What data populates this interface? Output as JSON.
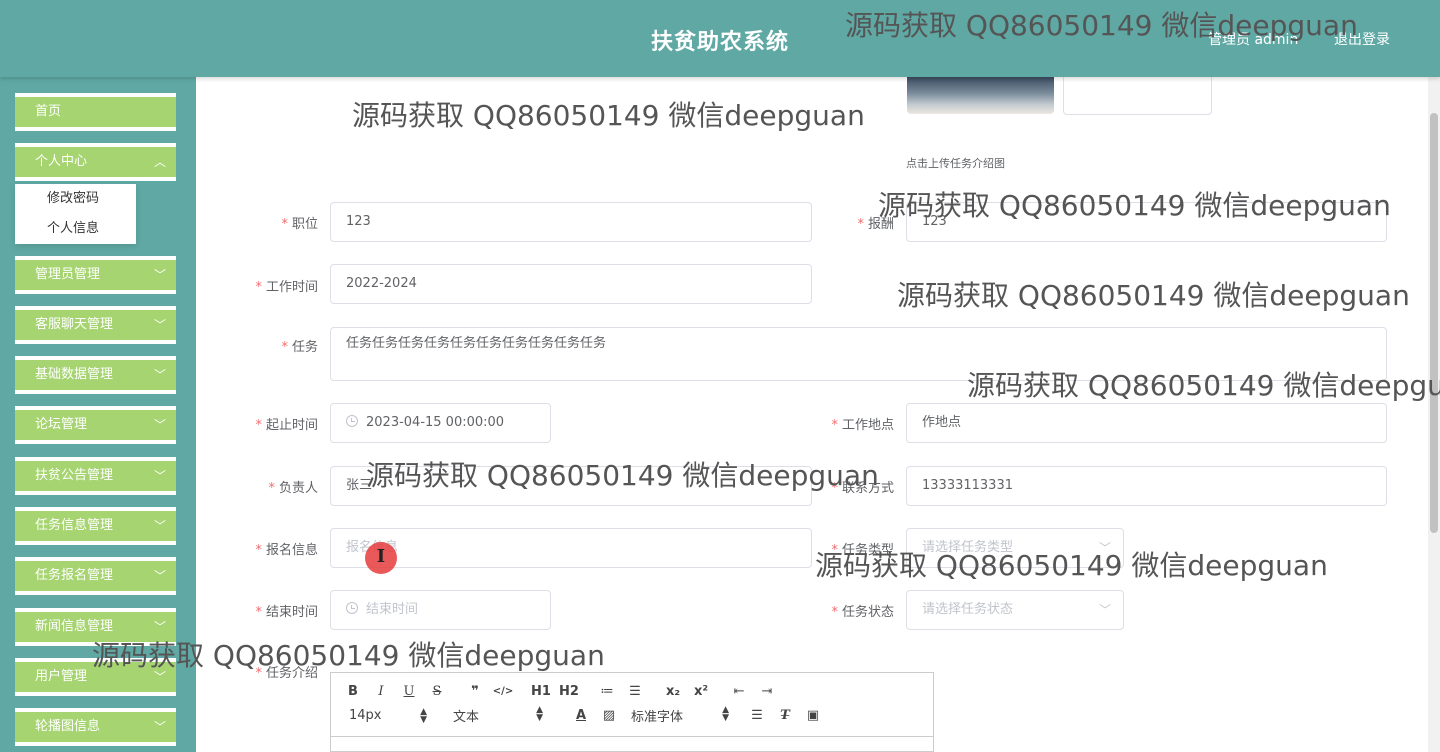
{
  "header": {
    "title": "扶贫助农系统",
    "admin": "管理员 admin",
    "logout": "退出登录"
  },
  "sidebar": {
    "items": [
      {
        "label": "首页"
      },
      {
        "label": "个人中心"
      },
      {
        "label": "管理员管理"
      },
      {
        "label": "客服聊天管理"
      },
      {
        "label": "基础数据管理"
      },
      {
        "label": "论坛管理"
      },
      {
        "label": "扶贫公告管理"
      },
      {
        "label": "任务信息管理"
      },
      {
        "label": "任务报名管理"
      },
      {
        "label": "新闻信息管理"
      },
      {
        "label": "用户管理"
      },
      {
        "label": "轮播图信息"
      }
    ],
    "submenu": [
      {
        "label": "修改密码"
      },
      {
        "label": "个人信息"
      }
    ]
  },
  "form": {
    "upload_hint": "点击上传任务介绍图",
    "position": {
      "label": "职位",
      "value": "123"
    },
    "salary": {
      "label": "报酬",
      "value": "123"
    },
    "work_time": {
      "label": "工作时间",
      "value": "2022-2024"
    },
    "task": {
      "label": "任务",
      "value": "任务任务任务任务任务任务任务任务任务任务"
    },
    "start_time": {
      "label": "起止时间",
      "value": "2023-04-15 00:00:00"
    },
    "work_place": {
      "label": "工作地点",
      "value": "作地点"
    },
    "manager": {
      "label": "负责人",
      "value": "张三"
    },
    "contact": {
      "label": "联系方式",
      "value": "13333113331"
    },
    "signup_info": {
      "label": "报名信息",
      "placeholder": "报名信息"
    },
    "task_type": {
      "label": "任务类型",
      "placeholder": "请选择任务类型"
    },
    "end_time": {
      "label": "结束时间",
      "placeholder": "结束时间"
    },
    "task_status": {
      "label": "任务状态",
      "placeholder": "请选择任务状态"
    },
    "task_intro": {
      "label": "任务介绍"
    }
  },
  "editor": {
    "row1": [
      "B",
      "I",
      "U",
      "S",
      "❞",
      "</>",
      "H1",
      "H2",
      "≔",
      "☰",
      "x₂",
      "x²",
      "⇤",
      "⇥"
    ],
    "font_size": "14px",
    "font_type": "文本",
    "font_family": "标准字体"
  },
  "watermark": "源码获取 QQ86050149 微信deepguan"
}
